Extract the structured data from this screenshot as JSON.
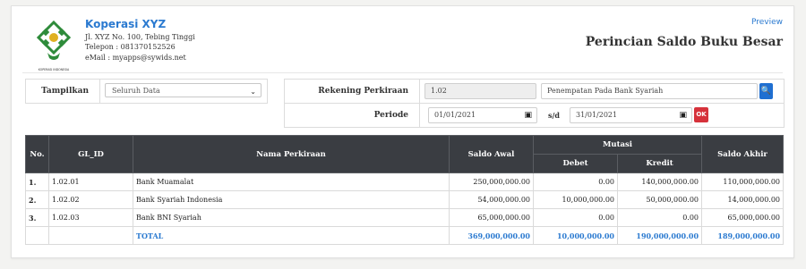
{
  "company": {
    "name": "Koperasi XYZ",
    "address": "Jl. XYZ No. 100, Tebing Tinggi",
    "phone": "Telepon : 081370152526",
    "email": "eMail : myapps@sywids.net",
    "logo_text": "KOPERASI INDONESIA",
    "logo_color": "#2e8b3a"
  },
  "header": {
    "preview_link": "Preview",
    "title": "Perincian Saldo Buku Besar"
  },
  "filters": {
    "tampilkan_label": "Tampilkan",
    "tampilkan_value": "Seluruh Data",
    "rekening_label": "Rekening Perkiraan",
    "rekening_code": "1.02",
    "rekening_name": "Penempatan Pada Bank Syariah",
    "periode_label": "Periode",
    "date_from": "01/01/2021",
    "sd_label": "s/d",
    "date_to": "31/01/2021",
    "ok_label": "OK"
  },
  "table": {
    "headers": {
      "no": "No.",
      "gl_id": "GL_ID",
      "nama": "Nama Perkiraan",
      "saldo_awal": "Saldo Awal",
      "mutasi": "Mutasi",
      "debet": "Debet",
      "kredit": "Kredit",
      "saldo_akhir": "Saldo Akhir"
    },
    "rows": [
      {
        "no": "1.",
        "gl_id": "1.02.01",
        "nama": "Bank Muamalat",
        "saldo_awal": "250,000,000.00",
        "debet": "0.00",
        "kredit": "140,000,000.00",
        "saldo_akhir": "110,000,000.00"
      },
      {
        "no": "2.",
        "gl_id": "1.02.02",
        "nama": "Bank Syariah Indonesia",
        "saldo_awal": "54,000,000.00",
        "debet": "10,000,000.00",
        "kredit": "50,000,000.00",
        "saldo_akhir": "14,000,000.00"
      },
      {
        "no": "3.",
        "gl_id": "1.02.03",
        "nama": "Bank BNI Syariah",
        "saldo_awal": "65,000,000.00",
        "debet": "0.00",
        "kredit": "0.00",
        "saldo_akhir": "65,000,000.00"
      }
    ],
    "total": {
      "label": "TOTAL",
      "saldo_awal": "369,000,000.00",
      "debet": "10,000,000.00",
      "kredit": "190,000,000.00",
      "saldo_akhir": "189,000,000.00"
    }
  }
}
